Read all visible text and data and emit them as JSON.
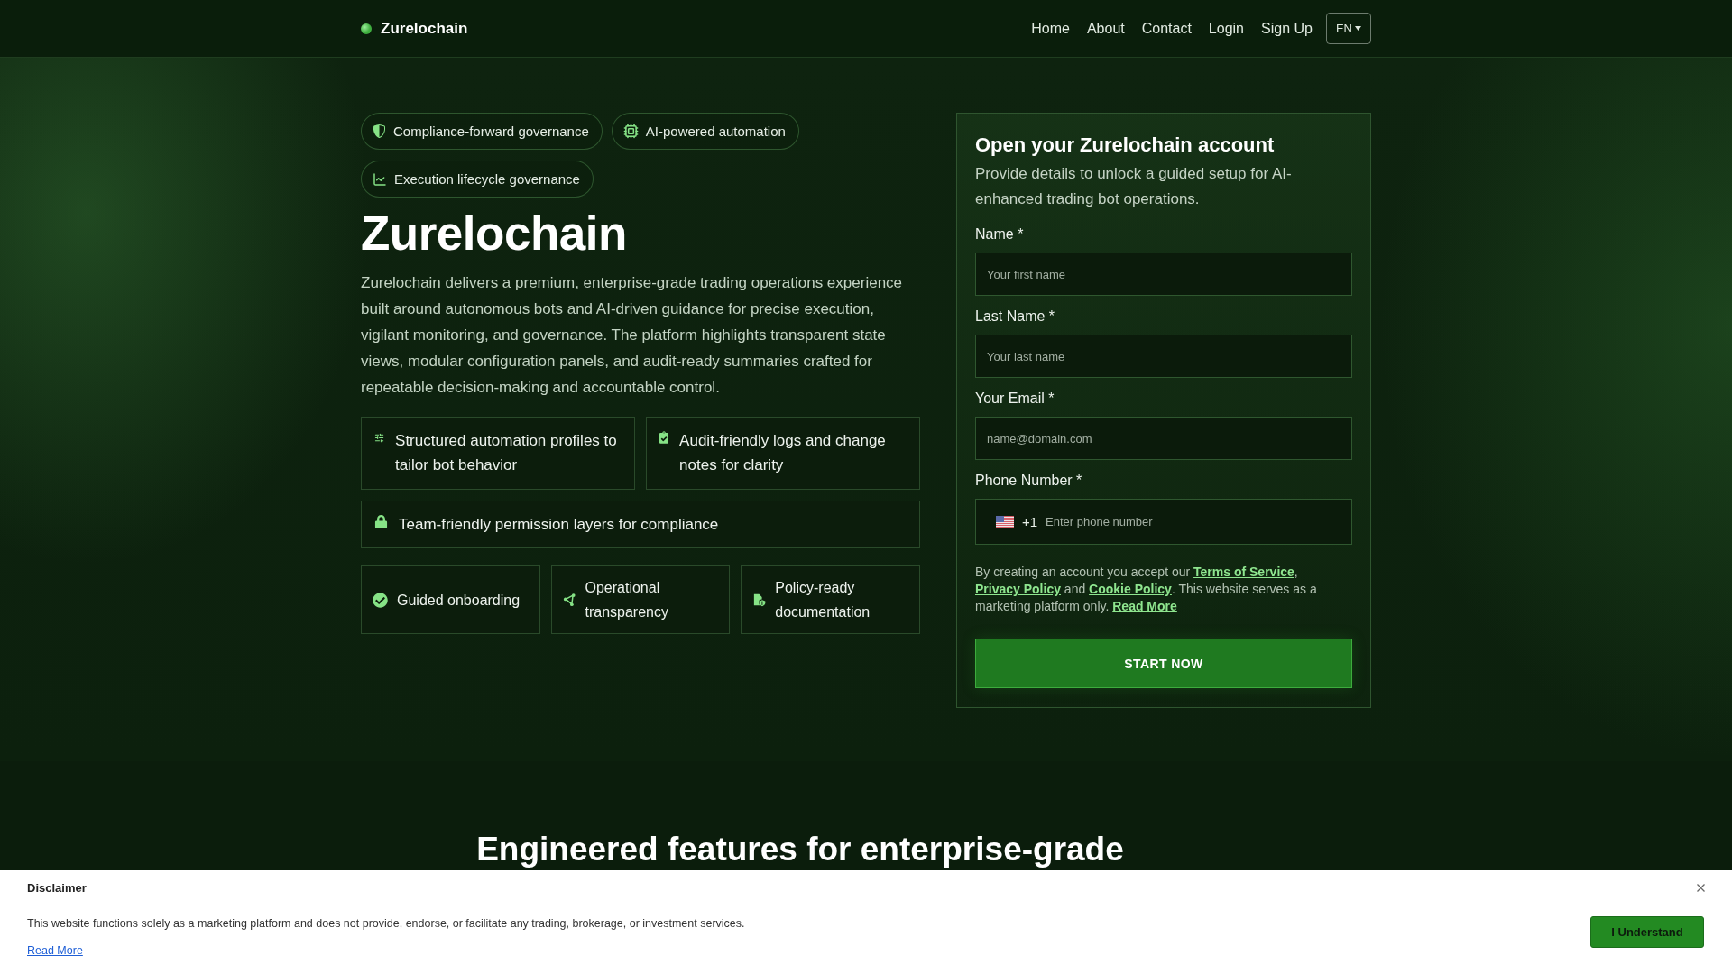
{
  "header": {
    "logo": "Zurelochain",
    "nav": [
      "Home",
      "About",
      "Contact",
      "Login",
      "Sign Up"
    ],
    "language": "EN"
  },
  "hero": {
    "chips": [
      "Compliance-forward governance",
      "AI-powered automation",
      "Execution lifecycle governance"
    ],
    "title": "Zurelochain",
    "description": "Zurelochain delivers a premium, enterprise-grade trading operations experience built around autonomous bots and AI-driven guidance for precise execution, vigilant monitoring, and governance. The platform highlights transparent state views, modular configuration panels, and audit-ready summaries crafted for repeatable decision-making and accountable control.",
    "highlights": [
      "Structured automation profiles to tailor bot behavior",
      "Audit-friendly logs and change notes for clarity",
      "Team-friendly permission layers for compliance"
    ],
    "features": [
      "Guided onboarding",
      "Operational transparency",
      "Policy-ready documentation"
    ]
  },
  "signup": {
    "title": "Open your Zurelochain account",
    "subtitle": "Provide details to unlock a guided setup for AI-enhanced trading bot operations.",
    "fields": [
      {
        "kind": "text",
        "label": "Name *",
        "placeholder": "Your first name"
      },
      {
        "kind": "text",
        "label": "Last Name *",
        "placeholder": "Your last name"
      },
      {
        "kind": "email",
        "label": "Your Email *",
        "placeholder": "name@domain.com"
      },
      {
        "kind": "phone",
        "label": "Phone Number *",
        "dial_code": "+1",
        "placeholder": "Enter phone number"
      }
    ],
    "consent": [
      {
        "kind": "text",
        "text": "By creating an account you accept our "
      },
      {
        "kind": "link",
        "text": "Terms of Service"
      },
      {
        "kind": "text",
        "text": ", "
      },
      {
        "kind": "link",
        "text": "Privacy Policy"
      },
      {
        "kind": "text",
        "text": " and "
      },
      {
        "kind": "link",
        "text": "Cookie Policy"
      },
      {
        "kind": "text",
        "text": ". This website serves as a marketing platform only. "
      },
      {
        "kind": "link",
        "text": "Read More"
      }
    ],
    "submit": "START NOW"
  },
  "features_section": {
    "title": "Engineered features for enterprise-grade"
  },
  "disclaimer": {
    "title": "Disclaimer",
    "text": "This website functions solely as a marketing platform and does not provide, endorse, or facilitate any trading, brokerage, or investment services.",
    "link": "Read More",
    "button": "I Understand"
  }
}
